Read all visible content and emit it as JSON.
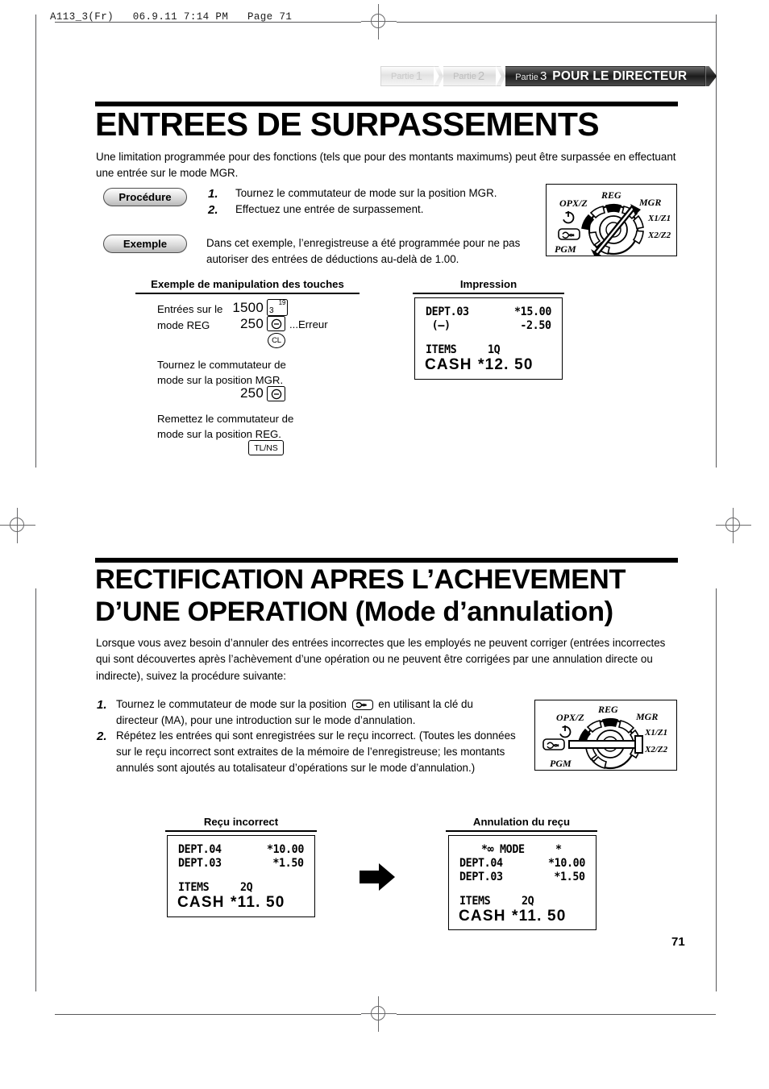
{
  "page": {
    "running_head": "A113_3(Fr)   06.9.11 7:14 PM   Page 71",
    "page_number": "71"
  },
  "tabs": [
    {
      "label": "Partie",
      "num": "1",
      "state": "inactive"
    },
    {
      "label": "Partie",
      "num": "2",
      "state": "inactive"
    },
    {
      "label": "Partie",
      "num": "3",
      "title": "POUR LE DIRECTEUR",
      "state": "active"
    }
  ],
  "section1": {
    "title": "ENTREES DE SURPASSEMENTS",
    "intro": "Une limitation programmée pour des fonctions (tels que pour des montants maximums) peut être surpassée en effectuant une entrée sur le mode MGR.",
    "procedure_label": "Procédure",
    "procedure_steps": [
      "Tournez le commutateur de mode sur la position MGR.",
      "Effectuez une entrée de surpassement."
    ],
    "example_label": "Exemple",
    "example_text": "Dans cet exemple, l’enregistreuse a été programmée pour ne pas autoriser des entrées de déductions au-delà de 1.00.",
    "keys_heading": "Exemple de manipulation des touches",
    "print_heading": "Impression",
    "keystrokes": {
      "label_line1": "Entrées sur le",
      "label_line2": "mode REG",
      "amount1": "1500",
      "key1_main": "3",
      "key1_sup": "19",
      "amount2": "250",
      "key2": "minus-key",
      "error_note": "...Erreur",
      "key3": "CL",
      "note1_line1": "Tournez le commutateur de",
      "note1_line2": "mode sur la position MGR.",
      "amount3": "250",
      "key4": "minus-key",
      "note2_line1": "Remettez le commutateur de",
      "note2_line2": "mode sur la position REG.",
      "key5": "TL/NS"
    },
    "receipt": {
      "rows": [
        {
          "left": "DEPT.03",
          "right": "*15.00"
        },
        {
          "left": " (—)",
          "right": "-2.50"
        }
      ],
      "items_label": "ITEMS",
      "items_value": "1Q",
      "total_label": "CASH",
      "total_value": "*12. 50"
    }
  },
  "section2": {
    "title_line1": "RECTIFICATION APRES L’ACHEVEMENT",
    "title_line2": "D’UNE OPERATION  (Mode d’annulation)",
    "intro": "Lorsque vous avez besoin d’annuler des entrées incorrectes que les employés ne peuvent corriger (entrées incorrectes qui sont découvertes après l’achèvement d’une opération ou ne peuvent être corrigées par une annulation directe ou indirecte), suivez la procédure suivante:",
    "steps": [
      {
        "num": "1.",
        "text_before": "Tournez le commutateur de mode sur la position",
        "icon": "void-mode-icon",
        "text_after": "en utilisant la clé du directeur (MA), pour une introduction sur le mode d’annulation."
      },
      {
        "num": "2.",
        "text_before": "Répétez les entrées qui sont enregistrées sur le reçu incorrect. (Toutes les données sur le reçu incorrect sont extraites de la mémoire de l’enregistreuse; les montants annulés sont ajoutés au totalisateur d’opérations sur le mode d’annulation.)",
        "icon": "",
        "text_after": ""
      }
    ],
    "receipt_bad_heading": "Reçu incorrect",
    "receipt_void_heading": "Annulation du reçu",
    "receipt_bad": {
      "rows": [
        {
          "left": "DEPT.04",
          "right": "*10.00"
        },
        {
          "left": "DEPT.03",
          "right": "*1.50"
        }
      ],
      "items_label": "ITEMS",
      "items_value": "2Q",
      "total_label": "CASH",
      "total_value": "*11. 50"
    },
    "receipt_void": {
      "header": "*∞ MODE     *",
      "rows": [
        {
          "left": "DEPT.04",
          "right": "*10.00"
        },
        {
          "left": "DEPT.03",
          "right": "*1.50"
        }
      ],
      "items_label": "ITEMS",
      "items_value": "2Q",
      "total_label": "CASH",
      "total_value": "*11. 50"
    }
  },
  "mode_dial": {
    "labels": {
      "reg": "REG",
      "mgr": "MGR",
      "opxz": "OPX/Z",
      "x1z1": "X1/Z1",
      "x2z2": "X2/Z2",
      "pgm": "PGM"
    },
    "dial_top_position": "MGR",
    "dial_bottom_position": "VOID"
  },
  "colors": {
    "ink": "#000000",
    "tab_active_bg": "#1b1b1b",
    "tab_inactive_text": "#c9c9c9",
    "crop_mark": "#58585a"
  }
}
